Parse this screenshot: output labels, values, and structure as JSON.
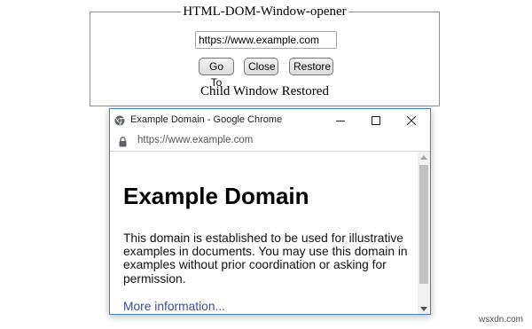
{
  "demo": {
    "legend": "HTML-DOM-Window-opener",
    "url_value": "https://www.example.com",
    "buttons": {
      "goto": "Go To",
      "close": "Close",
      "restore": "Restore"
    },
    "status": "Child Window Restored"
  },
  "child_window": {
    "title": "Example Domain - Google Chrome",
    "address": "https://www.example.com",
    "page": {
      "heading": "Example Domain",
      "paragraph": "This domain is established to be used for illustrative examples in documents. You may use this domain in examples without prior coordination or asking for permission.",
      "link": "More information..."
    },
    "icons": {
      "app": "chrome-icon",
      "lock": "lock-icon",
      "minimize": "minimize-icon",
      "maximize": "maximize-icon",
      "close": "close-icon"
    }
  },
  "watermark": "wsxdn.com",
  "colors": {
    "window_border": "#4a7fc1",
    "link": "#3a4ea0",
    "fieldset_border": "#8f8f8f"
  }
}
